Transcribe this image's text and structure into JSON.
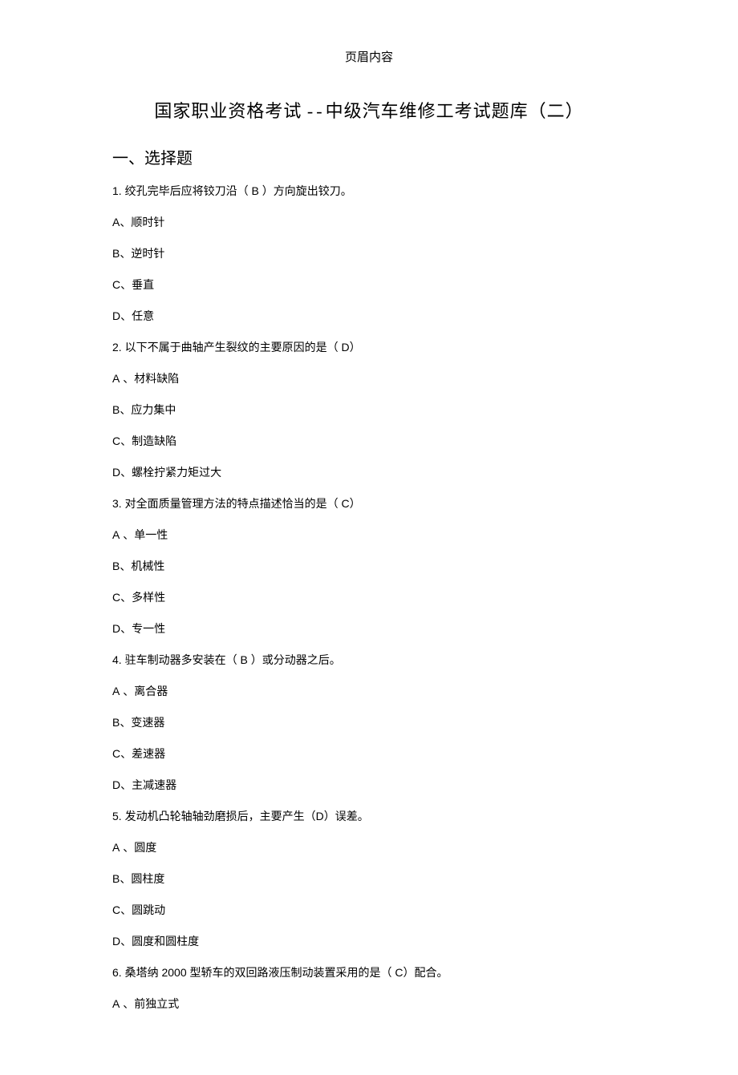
{
  "header": {
    "label": "页眉内容"
  },
  "title": {
    "part1": "国家职业资格考试",
    "sep": "--",
    "part2": "中级汽车维修工考试题库（二）"
  },
  "section": {
    "heading": "一、选择题"
  },
  "questions": [
    {
      "num": "1.",
      "text_before": " 绞孔完毕后应将铰刀沿（  ",
      "ans": "B",
      "text_after": " ）方向旋出铰刀。",
      "options": [
        {
          "letter": "A",
          "text": "、顺时针"
        },
        {
          "letter": "B",
          "text": "、逆时针"
        },
        {
          "letter": "C",
          "text": "、垂直"
        },
        {
          "letter": "D",
          "text": "、任意"
        }
      ]
    },
    {
      "num": "2.",
      "text_before": " 以下不属于曲轴产生裂纹的主要原因的是（        ",
      "ans": "D",
      "text_after": "）",
      "options": [
        {
          "letter": "A",
          "text": " 、材料缺陷"
        },
        {
          "letter": "B",
          "text": "、应力集中"
        },
        {
          "letter": "C",
          "text": "、制造缺陷"
        },
        {
          "letter": "D",
          "text": "、螺栓拧紧力矩过大"
        }
      ]
    },
    {
      "num": "3.",
      "text_before": " 对全面质量管理方法的特点描述恰当的是（       ",
      "ans": "C",
      "text_after": "）",
      "options": [
        {
          "letter": "A",
          "text": " 、单一性"
        },
        {
          "letter": "B",
          "text": "、机械性"
        },
        {
          "letter": "C",
          "text": "、多样性"
        },
        {
          "letter": "D",
          "text": "、专一性"
        }
      ]
    },
    {
      "num": "4.",
      "text_before": "  驻车制动器多安装在（  ",
      "ans": "B",
      "text_after": " ）或分动器之后。",
      "options": [
        {
          "letter": "A",
          "text": " 、离合器"
        },
        {
          "letter": "B",
          "text": "、变速器"
        },
        {
          "letter": "C",
          "text": "、差速器"
        },
        {
          "letter": "D",
          "text": "、主减速器"
        }
      ]
    },
    {
      "num": "5.",
      "text_before": "  发动机凸轮轴轴劲磨损后，主要产生（",
      "ans": "D",
      "text_after": "）误差。",
      "options": [
        {
          "letter": "A",
          "text": " 、圆度"
        },
        {
          "letter": "B",
          "text": "、圆柱度"
        },
        {
          "letter": "C",
          "text": "、圆跳动"
        },
        {
          "letter": "D",
          "text": "、圆度和圆柱度"
        }
      ]
    },
    {
      "num": "6.",
      "text_before": " 桑塔纳  2000 型轿车的双回路液压制动装置采用的是（        ",
      "ans": "C",
      "text_after": "）配合。",
      "options": [
        {
          "letter": "A",
          "text": " 、前独立式"
        }
      ]
    }
  ]
}
